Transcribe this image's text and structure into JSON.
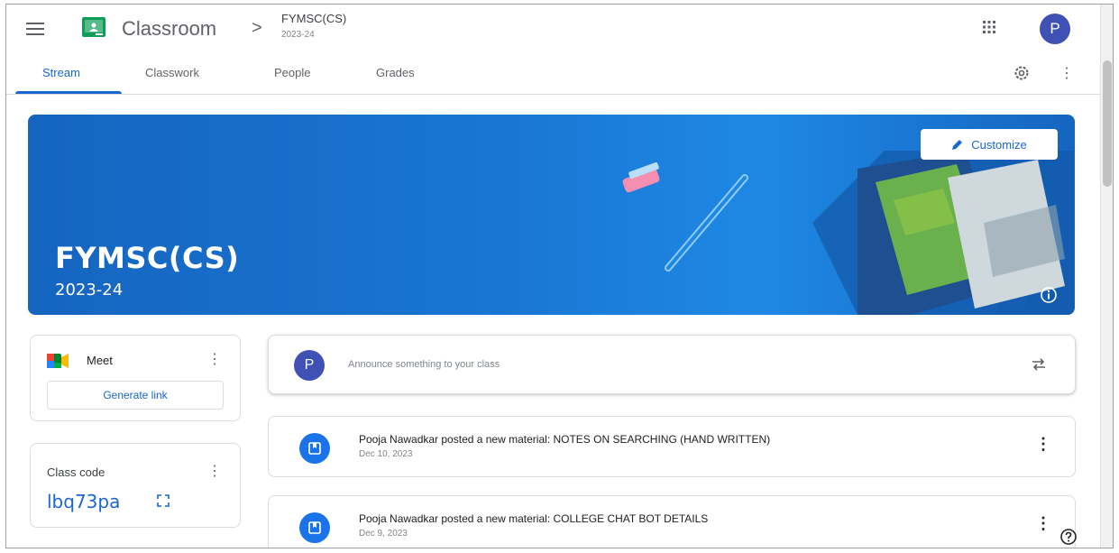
{
  "header": {
    "app_title": "Classroom",
    "breadcrumb_separator": ">",
    "class_name": "FYMSC(CS)",
    "class_section": "2023-24",
    "user_initial": "P"
  },
  "tabs": [
    {
      "label": "Stream",
      "active": true
    },
    {
      "label": "Classwork",
      "active": false
    },
    {
      "label": "People",
      "active": false
    },
    {
      "label": "Grades",
      "active": false
    }
  ],
  "banner": {
    "title": "FYMSC(CS)",
    "subtitle": "2023-24",
    "customize_label": "Customize",
    "color": "#1976d2"
  },
  "meet": {
    "label": "Meet",
    "button_label": "Generate link"
  },
  "class_code": {
    "label": "Class code",
    "value": "lbq73pa"
  },
  "announce": {
    "user_initial": "P",
    "placeholder": "Announce something to your class"
  },
  "posts": [
    {
      "title": "Pooja Nawadkar posted a new material: NOTES ON SEARCHING (HAND WRITTEN)",
      "date": "Dec 10, 2023"
    },
    {
      "title": "Pooja Nawadkar posted a new material: COLLEGE CHAT BOT DETAILS",
      "date": "Dec 9, 2023"
    }
  ],
  "colors": {
    "accent": "#1967d2",
    "avatar": "#3f51b5"
  }
}
